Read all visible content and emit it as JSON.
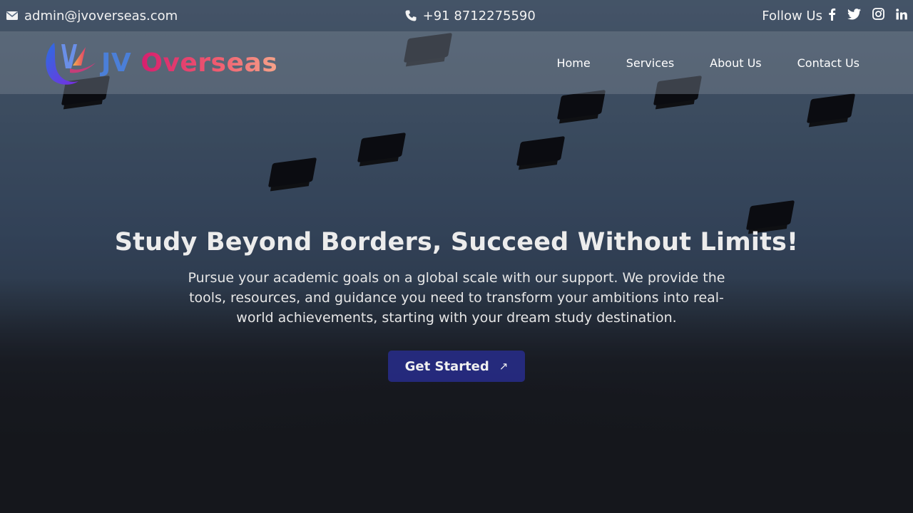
{
  "topbar": {
    "email": "admin@jvoverseas.com",
    "phone": "+91 8712275590",
    "follow_label": "Follow Us",
    "social_icons": [
      "facebook-icon",
      "twitter-icon",
      "instagram-icon",
      "linkedin-icon"
    ]
  },
  "header": {
    "logo_jv": "JV",
    "logo_overseas": "Overseas",
    "nav": [
      {
        "label": "Home"
      },
      {
        "label": "Services"
      },
      {
        "label": "About Us"
      },
      {
        "label": "Contact Us"
      }
    ]
  },
  "hero": {
    "title": "Study Beyond Borders, Succeed Without Limits!",
    "description": "Pursue your academic goals on a global scale with our support. We provide the tools, resources, and guidance you need to transform your ambitions into real-world achievements, starting with your dream study destination.",
    "cta_label": "Get Started",
    "cta_icon": "↗"
  },
  "colors": {
    "cta_bg": "#282d8c",
    "logo_blue": "#4b7fd8",
    "logo_pink": "#d61f6e",
    "logo_peach": "#f6a48a"
  }
}
